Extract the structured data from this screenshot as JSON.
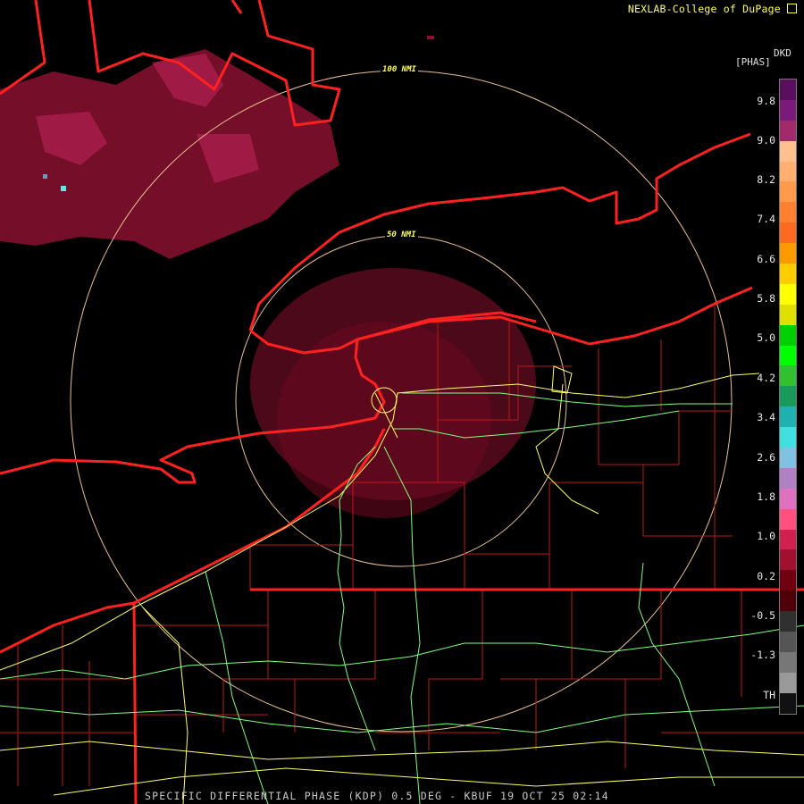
{
  "header": {
    "credit": "NEXLAB-College of DuPage"
  },
  "footer": {
    "product": "SPECIFIC DIFFERENTIAL PHASE (KDP) 0.5 DEG - KBUF 19 OCT 25 02:14"
  },
  "rings": {
    "outer_label": "100 NMI",
    "inner_label": "50 NMI"
  },
  "legend": {
    "units_top": "DKD",
    "units": "[PHAS]",
    "values": [
      "9.8",
      "9.0",
      "8.2",
      "7.4",
      "6.6",
      "5.8",
      "5.0",
      "4.2",
      "3.4",
      "2.6",
      "1.8",
      "1.0",
      "0.2",
      "-0.5",
      "-1.3",
      "TH"
    ],
    "colors": [
      "#5a0f5e",
      "#7a1a7a",
      "#a02a6a",
      "#ffc090",
      "#ffb070",
      "#ff9a4c",
      "#ff8030",
      "#ff6a20",
      "#ff9900",
      "#ffcc00",
      "#ffff00",
      "#e0e000",
      "#00d000",
      "#00ff00",
      "#30c030",
      "#1a9a5a",
      "#20b0b0",
      "#40e0e0",
      "#80c0e0",
      "#b080c0",
      "#e070c0",
      "#ff5080",
      "#d02050",
      "#a01030",
      "#700010",
      "#500008",
      "#303030",
      "#555555",
      "#777777",
      "#999999",
      "#111111"
    ],
    "icon": "expand-icon"
  }
}
